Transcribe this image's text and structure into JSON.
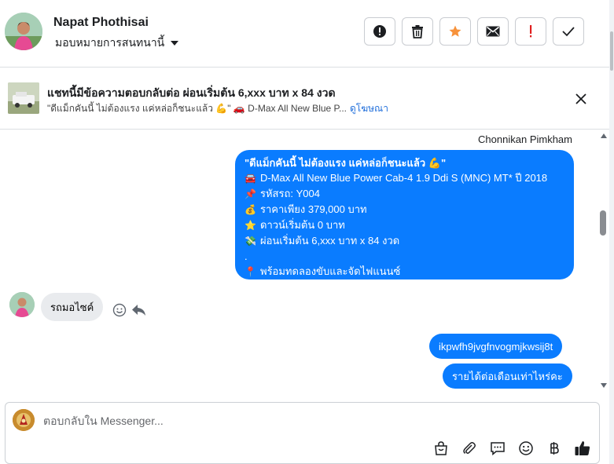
{
  "header": {
    "contact_name": "Napat Phothisai",
    "assign_label": "มอบหมายการสนทนานี้",
    "tools": [
      {
        "name": "mark-spam",
        "icon": "alert-circle-icon"
      },
      {
        "name": "delete",
        "icon": "trash-icon"
      },
      {
        "name": "star",
        "icon": "star-icon",
        "color": "#f7923b"
      },
      {
        "name": "mark-unread",
        "icon": "envelope-icon"
      },
      {
        "name": "follow-up",
        "icon": "exclamation-icon",
        "color": "#e02020"
      },
      {
        "name": "mark-done",
        "icon": "check-icon"
      }
    ]
  },
  "ad": {
    "title": "แชทนี้มีข้อความตอบกลับต่อ ผ่อนเริ่มต้น 6,xxx บาท x 84 งวด",
    "subtitle": "\"ดีแม็กคันนี้ ไม่ต้องแรง แค่หล่อก็ชนะแล้ว 💪\" 🚗 D-Max All New Blue P...",
    "link_label": "ดูโฆษณา"
  },
  "chat": {
    "outgoing_sender": "Chonnikan Pimkham",
    "ad_message": [
      {
        "icon": "",
        "text": "\"ดีแม็กคันนี้ ไม่ต้องแรง แค่หล่อก็ชนะแล้ว 💪\""
      },
      {
        "icon": "🚘",
        "text": "D-Max All New Blue Power Cab-4 1.9 Ddi S (MNC) MT* ปี 2018"
      },
      {
        "icon": "📌",
        "text": "รหัสรถ: Y004"
      },
      {
        "icon": "💰",
        "text": "ราคาเพียง 379,000 บาท"
      },
      {
        "icon": "⭐",
        "text": "ดาวน์เริ่มต้น 0 บาท"
      },
      {
        "icon": "💸",
        "text": "ผ่อนเริ่มต้น 6,xxx บาท x 84 งวด"
      },
      {
        "icon": "",
        "text": "."
      },
      {
        "icon": "📍",
        "text": "พร้อมทดลองขับและจัดไฟแนนซ์"
      }
    ],
    "incoming_message": "รถมอไซค์",
    "outgoing_messages": [
      "ikpwfh9jvgfnvogmjkwsij8t",
      "รายได้ต่อเดือนเท่าไหร่คะ"
    ]
  },
  "composer": {
    "placeholder": "ตอบกลับใน Messenger...",
    "icons": [
      "shopping-bag-icon",
      "paperclip-icon",
      "saved-reply-icon",
      "emoji-icon",
      "baht-icon",
      "thumbs-up-icon"
    ]
  },
  "colors": {
    "accent": "#0a7cff",
    "incoming_bubble": "#e9ebee"
  }
}
